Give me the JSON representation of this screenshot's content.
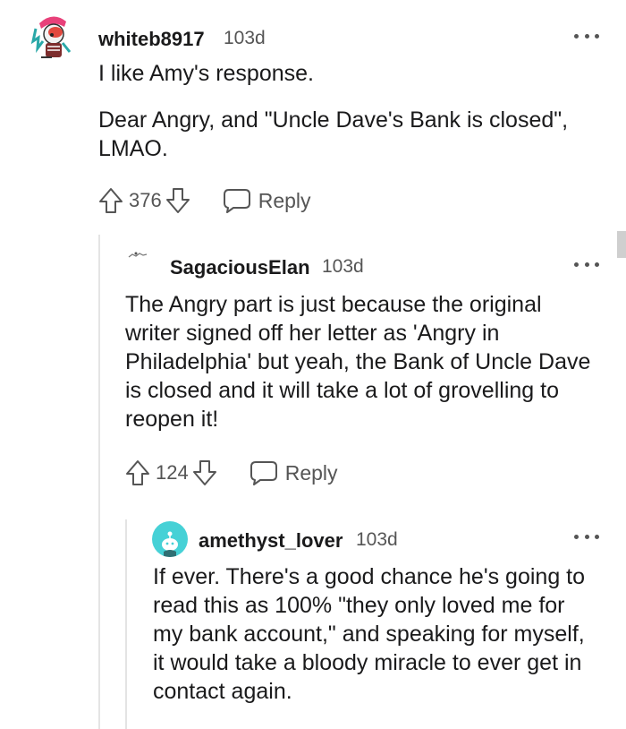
{
  "comments": [
    {
      "username": "whiteb8917",
      "age": "103d",
      "paragraphs": [
        "I like Amy's response.",
        "Dear Angry, and \"Uncle Dave's Bank is closed\", LMAO."
      ],
      "score": "376",
      "reply_label": "Reply",
      "avatar_icon": "snoo-avatar-pirate-icon"
    },
    {
      "username": "SagaciousElan",
      "age": "103d",
      "paragraphs": [
        "The Angry part is just because the original writer signed off her letter as 'Angry in Philadelphia' but yeah, the Bank of Uncle Dave is closed and it will take a lot of grovelling to reopen it!"
      ],
      "score": "124",
      "reply_label": "Reply",
      "avatar_icon": "small-sketch-avatar-icon"
    },
    {
      "username": "amethyst_lover",
      "age": "103d",
      "paragraphs": [
        "If ever. There's a good chance he's going to read this as 100% \"they only loved me for my bank account,\" and speaking for myself, it would take a bloody miracle to ever get in contact again."
      ],
      "avatar_icon": "default-snoo-teal-avatar-icon"
    }
  ],
  "colors": {
    "text": "#1a1a1b",
    "meta": "#555555",
    "thread_line": "#e4e4e4",
    "teal_avatar": "#46d1d6"
  }
}
